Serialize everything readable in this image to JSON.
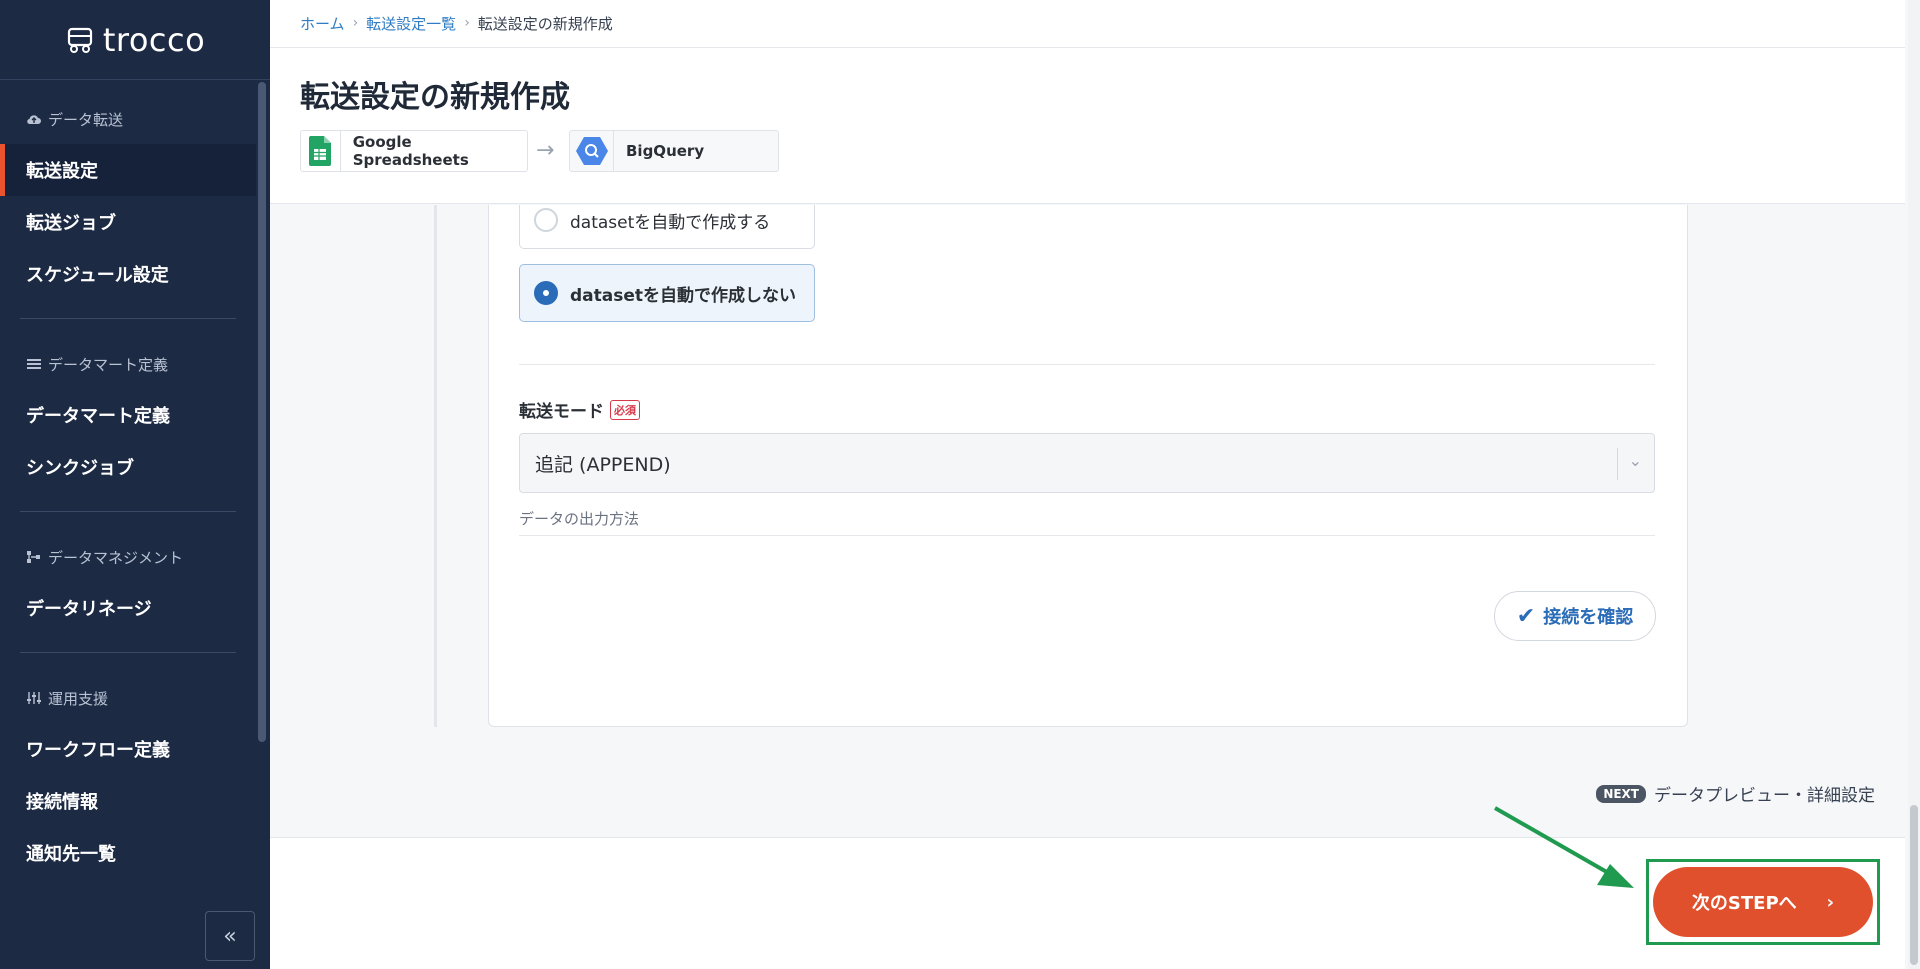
{
  "app": {
    "brand": "trocco"
  },
  "sidebar": {
    "sections": [
      {
        "title": "データ転送",
        "icon": "cloud-upload-icon",
        "items": [
          "転送設定",
          "転送ジョブ",
          "スケジュール設定"
        ]
      },
      {
        "title": "データマート定義",
        "icon": "list-icon",
        "items": [
          "データマート定義",
          "シンクジョブ"
        ]
      },
      {
        "title": "データマネジメント",
        "icon": "lineage-icon",
        "items": [
          "データリネージ"
        ]
      },
      {
        "title": "運用支援",
        "icon": "sliders-icon",
        "items": [
          "ワークフロー定義",
          "接続情報",
          "通知先一覧"
        ]
      }
    ],
    "active_item": "転送設定",
    "collapse_label": "«"
  },
  "breadcrumb": {
    "home": "ホーム",
    "list": "転送設定一覧",
    "current": "転送設定の新規作成"
  },
  "page": {
    "title": "転送設定の新規作成",
    "source": {
      "label": "Google Spreadsheets",
      "icon": "google-sheets-icon"
    },
    "destination": {
      "label": "BigQuery",
      "icon": "bigquery-icon"
    }
  },
  "form": {
    "dataset_options": [
      {
        "label": "datasetを自動で作成する",
        "selected": false
      },
      {
        "label": "datasetを自動で作成しない",
        "selected": true
      }
    ],
    "transfer_mode": {
      "label": "転送モード",
      "required_badge": "必須",
      "value": "追記 (APPEND)",
      "help": "データの出力方法"
    },
    "check_connection": "接続を確認"
  },
  "next": {
    "badge": "NEXT",
    "text": "データプレビュー・詳細設定",
    "button": "次のSTEPへ"
  },
  "colors": {
    "accent": "#e0502c",
    "sidebar_bg": "#1c2a44",
    "link": "#2f7cc4",
    "highlight_box": "#1f9a4f"
  }
}
